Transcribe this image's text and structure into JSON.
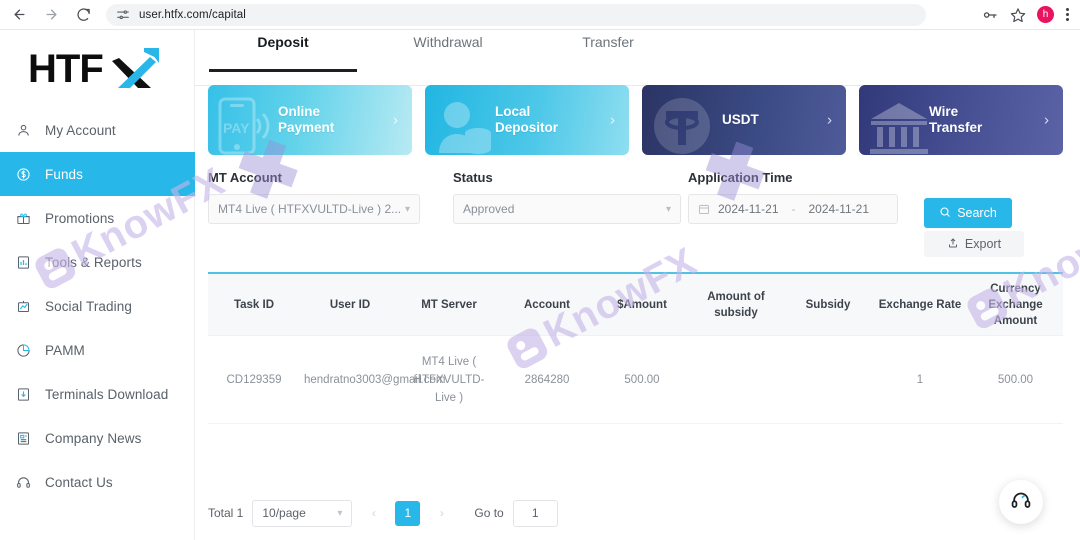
{
  "browser": {
    "back_icon": "back-arrow-icon",
    "forward_icon": "forward-arrow-icon",
    "reload_icon": "reload-icon",
    "url": "user.htfx.com/capital",
    "site_info_icon": "site-settings-icon",
    "password_icon": "password-key-icon",
    "bookmark_icon": "star-icon",
    "avatar_initial": "h",
    "menu_icon": "kebab-menu-icon"
  },
  "sidebar": {
    "logo_text": "HTFX",
    "items": [
      {
        "label": "My Account",
        "icon": "user-icon",
        "active": false
      },
      {
        "label": "Funds",
        "icon": "dollar-circle-icon",
        "active": true
      },
      {
        "label": "Promotions",
        "icon": "gift-icon",
        "active": false
      },
      {
        "label": "Tools & Reports",
        "icon": "chart-document-icon",
        "active": false
      },
      {
        "label": "Social Trading",
        "icon": "trending-board-icon",
        "active": false
      },
      {
        "label": "PAMM",
        "icon": "pie-chart-icon",
        "active": false
      },
      {
        "label": "Terminals Download",
        "icon": "download-box-icon",
        "active": false
      },
      {
        "label": "Company News",
        "icon": "news-document-icon",
        "active": false
      },
      {
        "label": "Contact Us",
        "icon": "headphones-icon",
        "active": false
      }
    ]
  },
  "tabs": [
    {
      "label": "Deposit",
      "active": true
    },
    {
      "label": "Withdrawal",
      "active": false
    },
    {
      "label": "Transfer",
      "active": false
    }
  ],
  "payment_cards": [
    {
      "line1": "Online",
      "line2": "Payment",
      "icon": "mobile-pay-icon",
      "chevron": "chevron-right-icon",
      "color": "#36c0e8"
    },
    {
      "line1": "Local",
      "line2": "Depositor",
      "icon": "person-coins-icon",
      "chevron": "chevron-right-icon",
      "color": "#21b6e2"
    },
    {
      "line1": "USDT",
      "line2": "",
      "icon": "tether-coin-icon",
      "chevron": "chevron-right-icon",
      "color": "#2b3464"
    },
    {
      "line1": "Wire",
      "line2": "Transfer",
      "icon": "bank-building-icon",
      "chevron": "chevron-right-icon",
      "color": "#31397a"
    }
  ],
  "filters": {
    "mt_account": {
      "label": "MT Account",
      "value": "MT4 Live ( HTFXVULTD-Live ) 2...",
      "caret": "chevron-down-icon"
    },
    "status": {
      "label": "Status",
      "value": "Approved",
      "caret": "chevron-down-icon"
    },
    "application_time": {
      "label": "Application Time",
      "calendar_icon": "calendar-icon",
      "start": "2024-11-21",
      "separator": "-",
      "end": "2024-11-21"
    },
    "search_button": {
      "label": "Search",
      "icon": "search-icon"
    },
    "export_button": {
      "label": "Export",
      "icon": "upload-export-icon"
    }
  },
  "table": {
    "columns": [
      "Task ID",
      "User ID",
      "MT Server",
      "Account",
      "$Amount",
      "Amount of subsidy",
      "Subsidy",
      "Exchange Rate",
      "Currency Exchange Amount"
    ],
    "rows": [
      {
        "task_id": "CD129359",
        "user_id": "hendratno3003@gmail.com",
        "mt_server": "MT4 Live ( HTFXVULTD-Live )",
        "account": "2864280",
        "amount": "500.00",
        "amount_of_subsidy": "",
        "subsidy": "",
        "exchange_rate": "1",
        "currency_exchange_amount": "500.00"
      }
    ]
  },
  "pagination": {
    "total": "Total 1",
    "page_size": "10/page",
    "page_size_caret": "chevron-down-icon",
    "prev_icon": "chevron-left-icon",
    "current_page": "1",
    "next_icon": "chevron-right-icon",
    "goto_label": "Go to",
    "goto_value": "1"
  },
  "support": {
    "icon": "headphones-support-icon"
  },
  "watermark": {
    "text": "KnowFX"
  }
}
